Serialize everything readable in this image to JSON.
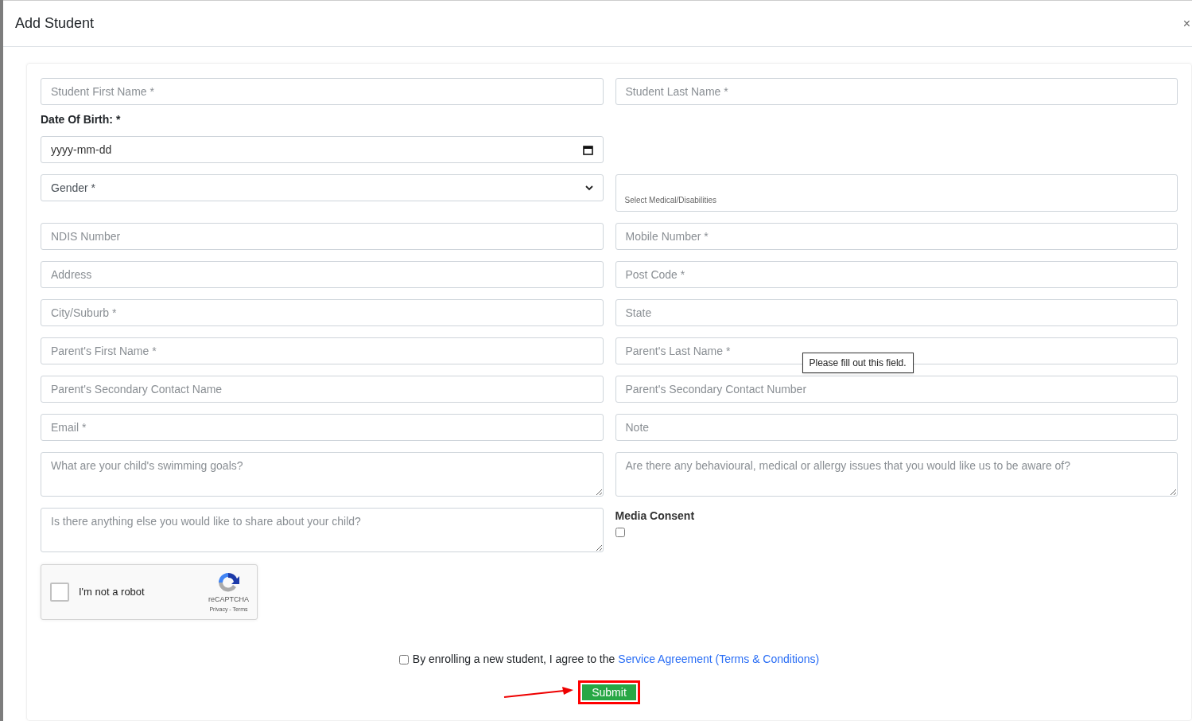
{
  "modal": {
    "title": "Add Student",
    "close": "×"
  },
  "rows": [
    {
      "left": {
        "kind": "text",
        "placeholder": "Student First Name *"
      },
      "right": {
        "kind": "text",
        "placeholder": "Student Last Name *"
      }
    },
    {
      "left": {
        "kind": "date",
        "label": "Date Of Birth: *",
        "placeholder": "yyyy-mm-dd"
      }
    },
    {
      "left": {
        "kind": "select",
        "value": "Gender *"
      },
      "right": {
        "kind": "multiselect",
        "placeholder": "Select Medical/Disabilities"
      }
    },
    {
      "left": {
        "kind": "text",
        "placeholder": "NDIS Number"
      },
      "right": {
        "kind": "text",
        "placeholder": "Mobile Number *"
      }
    },
    {
      "left": {
        "kind": "text",
        "placeholder": "Address"
      },
      "right": {
        "kind": "text",
        "placeholder": "Post Code *"
      }
    },
    {
      "left": {
        "kind": "text",
        "placeholder": "City/Suburb *"
      },
      "right": {
        "kind": "text",
        "placeholder": "State"
      }
    },
    {
      "left": {
        "kind": "text",
        "placeholder": "Parent's First Name *"
      },
      "right": {
        "kind": "text",
        "placeholder": "Parent's Last Name *",
        "tooltip": "Please fill out this field."
      }
    },
    {
      "left": {
        "kind": "text",
        "placeholder": "Parent's Secondary Contact Name"
      },
      "right": {
        "kind": "text",
        "placeholder": "Parent's Secondary Contact Number"
      }
    },
    {
      "left": {
        "kind": "text",
        "placeholder": "Email *"
      },
      "right": {
        "kind": "text",
        "placeholder": "Note"
      }
    },
    {
      "left": {
        "kind": "textarea",
        "placeholder": "What are your child's swimming goals?"
      },
      "right": {
        "kind": "textarea",
        "placeholder": "Are there any behavioural, medical or allergy issues that you would like us to be aware of?"
      }
    },
    {
      "left": {
        "kind": "textarea",
        "placeholder": "Is there anything else you would like to share about your child?"
      },
      "right": {
        "kind": "checkbox",
        "label": "Media Consent",
        "checked": false
      }
    }
  ],
  "captcha": {
    "label": "I'm not a robot",
    "checked": false,
    "brand": "reCAPTCHA",
    "links": "Privacy - Terms"
  },
  "agreement": {
    "checked": false,
    "text": "By enrolling a new student, I agree to the",
    "link": "Service Agreement (Terms & Conditions)"
  },
  "submit": {
    "label": "Submit",
    "highlighted": true
  }
}
